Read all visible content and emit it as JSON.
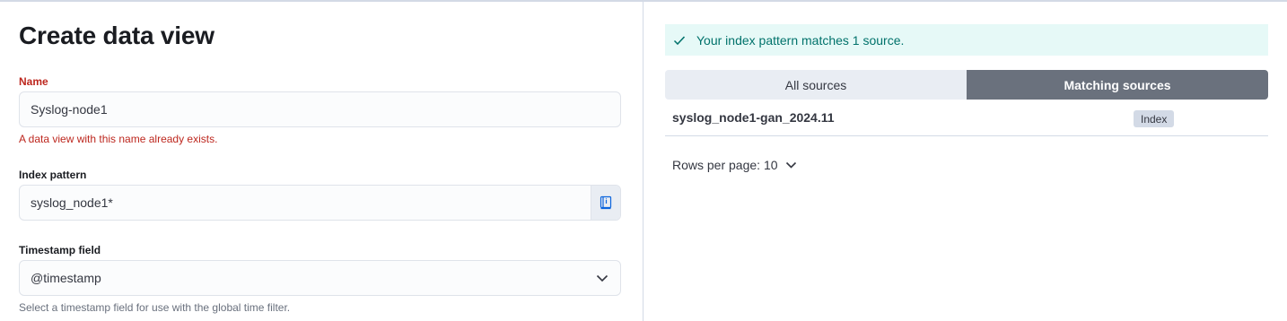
{
  "page": {
    "title": "Create data view"
  },
  "name_field": {
    "label": "Name",
    "value": "Syslog-node1",
    "error": "A data view with this name already exists."
  },
  "index_field": {
    "label": "Index pattern",
    "value": "syslog_node1*",
    "append_icon": "book-icon"
  },
  "timestamp_field": {
    "label": "Timestamp field",
    "value": "@timestamp",
    "help": "Select a timestamp field for use with the global time filter."
  },
  "callout": {
    "text": "Your index pattern matches 1 source.",
    "icon": "check-icon",
    "color": "#00726b"
  },
  "tabs": [
    {
      "label": "All sources",
      "active": false
    },
    {
      "label": "Matching sources",
      "active": true
    }
  ],
  "sources": [
    {
      "name": "syslog_node1-gan_2024.11",
      "type": "Index"
    }
  ],
  "pagination": {
    "rows_per_page_label": "Rows per page: 10"
  },
  "colors": {
    "error": "#bd271e",
    "success_bg": "#e6f9f7",
    "active_tab": "#6a717d"
  }
}
